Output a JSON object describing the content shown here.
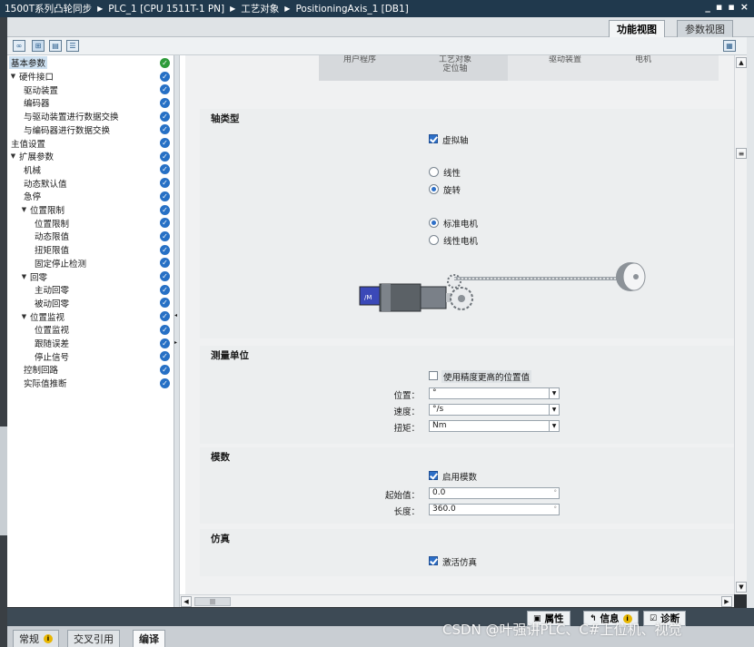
{
  "titlebar": {
    "crumbs": [
      "1500T系列凸轮同步",
      "PLC_1 [CPU 1511T-1 PN]",
      "工艺对象",
      "PositioningAxis_1 [DB1]"
    ],
    "window_buttons": [
      "_",
      "▪",
      "▪",
      "×"
    ]
  },
  "views": {
    "functional": "功能视图",
    "parameter": "参数视图"
  },
  "nav": {
    "items": [
      {
        "label": "基本参数",
        "depth": 0,
        "arrow": "",
        "status": "ok",
        "selected": true
      },
      {
        "label": "硬件接口",
        "depth": 0,
        "arrow": "▼",
        "status": "chk"
      },
      {
        "label": "驱动装置",
        "depth": 1,
        "arrow": "",
        "status": "chk"
      },
      {
        "label": "编码器",
        "depth": 1,
        "arrow": "",
        "status": "chk"
      },
      {
        "label": "与驱动装置进行数据交换",
        "depth": 1,
        "arrow": "",
        "status": "chk"
      },
      {
        "label": "与编码器进行数据交换",
        "depth": 1,
        "arrow": "",
        "status": "chk"
      },
      {
        "label": "主值设置",
        "depth": 0,
        "arrow": "",
        "status": "chk"
      },
      {
        "label": "扩展参数",
        "depth": 0,
        "arrow": "▼",
        "status": "chk"
      },
      {
        "label": "机械",
        "depth": 1,
        "arrow": "",
        "status": "chk"
      },
      {
        "label": "动态默认值",
        "depth": 1,
        "arrow": "",
        "status": "chk"
      },
      {
        "label": "急停",
        "depth": 1,
        "arrow": "",
        "status": "chk"
      },
      {
        "label": "位置限制",
        "depth": 1,
        "arrow": "▼",
        "status": "chk"
      },
      {
        "label": "位置限制",
        "depth": 2,
        "arrow": "",
        "status": "chk"
      },
      {
        "label": "动态限值",
        "depth": 2,
        "arrow": "",
        "status": "chk"
      },
      {
        "label": "扭矩限值",
        "depth": 2,
        "arrow": "",
        "status": "chk"
      },
      {
        "label": "固定停止检测",
        "depth": 2,
        "arrow": "",
        "status": "chk"
      },
      {
        "label": "回零",
        "depth": 1,
        "arrow": "▼",
        "status": "chk"
      },
      {
        "label": "主动回零",
        "depth": 2,
        "arrow": "",
        "status": "chk"
      },
      {
        "label": "被动回零",
        "depth": 2,
        "arrow": "",
        "status": "chk"
      },
      {
        "label": "位置监视",
        "depth": 1,
        "arrow": "▼",
        "status": "chk"
      },
      {
        "label": "位置监视",
        "depth": 2,
        "arrow": "",
        "status": "chk"
      },
      {
        "label": "跟随误差",
        "depth": 2,
        "arrow": "",
        "status": "chk"
      },
      {
        "label": "停止信号",
        "depth": 2,
        "arrow": "",
        "status": "chk"
      },
      {
        "label": "控制回路",
        "depth": 1,
        "arrow": "",
        "status": "chk"
      },
      {
        "label": "实际值推断",
        "depth": 1,
        "arrow": "",
        "status": "chk"
      }
    ]
  },
  "header_graphic": {
    "user_program": "用户程序",
    "tech_object": "工艺对象\n定位轴",
    "drive": "驱动装置",
    "motor": "电机"
  },
  "axis_type": {
    "title": "轴类型",
    "virtual_axis": {
      "label": "虚拟轴",
      "checked": true
    },
    "linear": "线性",
    "rotary": "旋转",
    "rotation_selected": "rotary",
    "standard_motor": "标准电机",
    "linear_motor": "线性电机",
    "motor_selected": "standard",
    "motor_badge": "/M"
  },
  "units": {
    "title": "测量单位",
    "high_precision": {
      "label": "使用精度更高的位置值",
      "checked": false
    },
    "position": {
      "label": "位置：",
      "value": "°"
    },
    "velocity": {
      "label": "速度：",
      "value": "°/s"
    },
    "torque": {
      "label": "扭矩：",
      "value": "Nm"
    }
  },
  "modulo": {
    "title": "模数",
    "enable": {
      "label": "启用模数",
      "checked": true
    },
    "start": {
      "label": "起始值：",
      "value": "0.0"
    },
    "length": {
      "label": "长度：",
      "value": "360.0"
    }
  },
  "simulation": {
    "title": "仿真",
    "activate": {
      "label": "激活仿真",
      "checked": true
    }
  },
  "inspector": {
    "properties": "属性",
    "info": "信息",
    "diagnostics": "诊断"
  },
  "bottom_tabs": {
    "general": "常规",
    "cross_ref": "交叉引用",
    "compile": "编译"
  },
  "watermark": "CSDN @叶强讲PLC、C#上位机、视觉",
  "colors": {
    "ok": "#2e9b3a",
    "check": "#2670c5",
    "titlebar": "#20394d"
  }
}
